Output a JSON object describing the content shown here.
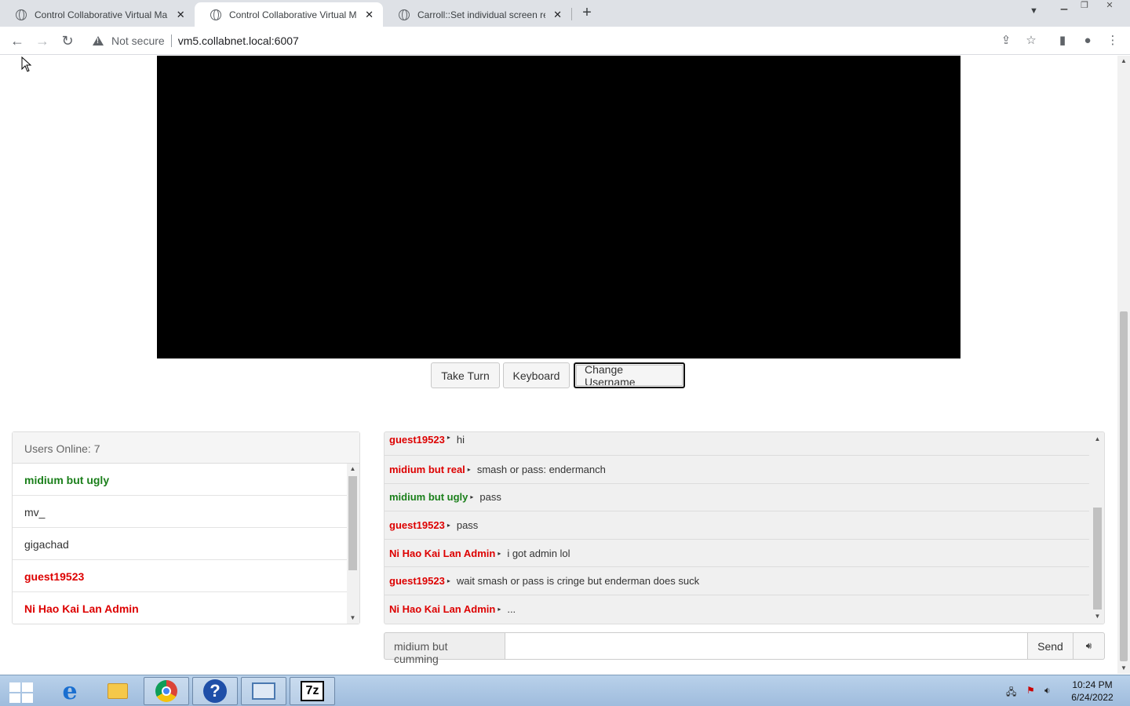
{
  "browser": {
    "tabs": [
      {
        "title": "Control Collaborative Virtual Ma",
        "active": false
      },
      {
        "title": "Control Collaborative Virtual Ma",
        "active": true
      },
      {
        "title": "Carroll::Set individual screen reso",
        "active": false
      }
    ],
    "security_label": "Not secure",
    "url": "vm5.collabnet.local:6007"
  },
  "vm": {
    "buttons": {
      "take_turn": "Take Turn",
      "keyboard": "Keyboard",
      "change_username": "Change Username"
    }
  },
  "users": {
    "header": "Users Online: 7",
    "list": [
      {
        "name": "midium but ugly",
        "style": "green"
      },
      {
        "name": "mv_",
        "style": "normal"
      },
      {
        "name": "gigachad",
        "style": "normal"
      },
      {
        "name": "guest19523",
        "style": "admin"
      },
      {
        "name": "Ni Hao Kai Lan Admin",
        "style": "admin"
      }
    ]
  },
  "chat": {
    "messages": [
      {
        "user": "guest19523",
        "color": "red",
        "text": "hi"
      },
      {
        "user": "midium but real",
        "color": "red",
        "text": "smash or pass: endermanch"
      },
      {
        "user": "midium but ugly",
        "color": "green",
        "text": "pass"
      },
      {
        "user": "guest19523",
        "color": "red",
        "text": "pass"
      },
      {
        "user": "Ni Hao Kai Lan Admin",
        "color": "red",
        "text": "i got admin lol"
      },
      {
        "user": "guest19523",
        "color": "red",
        "text": "wait smash or pass is cringe but enderman does suck"
      },
      {
        "user": "Ni Hao Kai Lan Admin",
        "color": "red",
        "text": "..."
      }
    ],
    "username": "midium but cumming",
    "input_value": "",
    "send_label": "Send"
  },
  "taskbar": {
    "clock_time": "10:24 PM",
    "clock_date": "6/24/2022"
  }
}
